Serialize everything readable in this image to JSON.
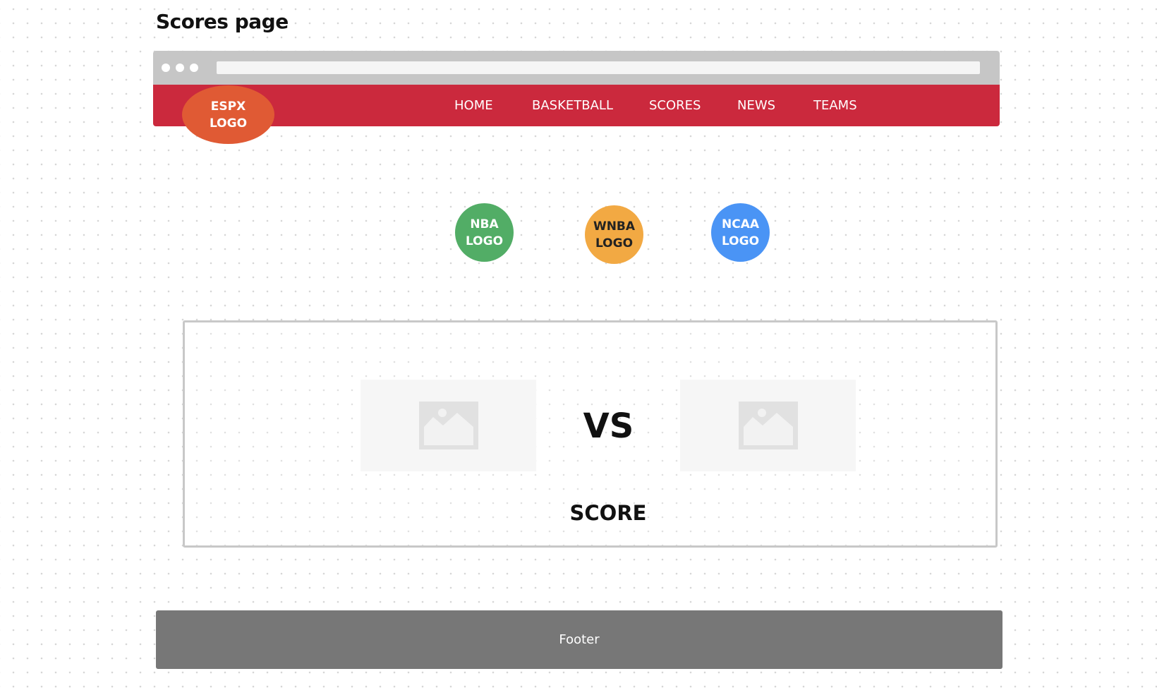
{
  "page": {
    "title": "Scores page"
  },
  "colors": {
    "navbar": "#cb293d",
    "espx_logo": "#e05a34",
    "nba": "#52ad66",
    "wnba": "#f2a943",
    "ncaa": "#4a94f5",
    "footer": "#777777",
    "chrome": "#c6c6c6"
  },
  "header": {
    "logo": {
      "line1": "ESPX",
      "line2": "LOGO"
    },
    "nav": {
      "items": [
        {
          "label": "HOME"
        },
        {
          "label": "BASKETBALL"
        },
        {
          "label": "SCORES"
        },
        {
          "label": "NEWS"
        },
        {
          "label": "TEAMS"
        }
      ]
    }
  },
  "leagues": [
    {
      "line1": "NBA",
      "line2": "LOGO"
    },
    {
      "line1": "WNBA",
      "line2": "LOGO"
    },
    {
      "line1": "NCAA",
      "line2": "LOGO"
    }
  ],
  "matchup": {
    "team1_image_icon": "image-placeholder-icon",
    "vs_label": "VS",
    "team2_image_icon": "image-placeholder-icon",
    "score_label": "SCORE"
  },
  "footer": {
    "label": "Footer"
  }
}
